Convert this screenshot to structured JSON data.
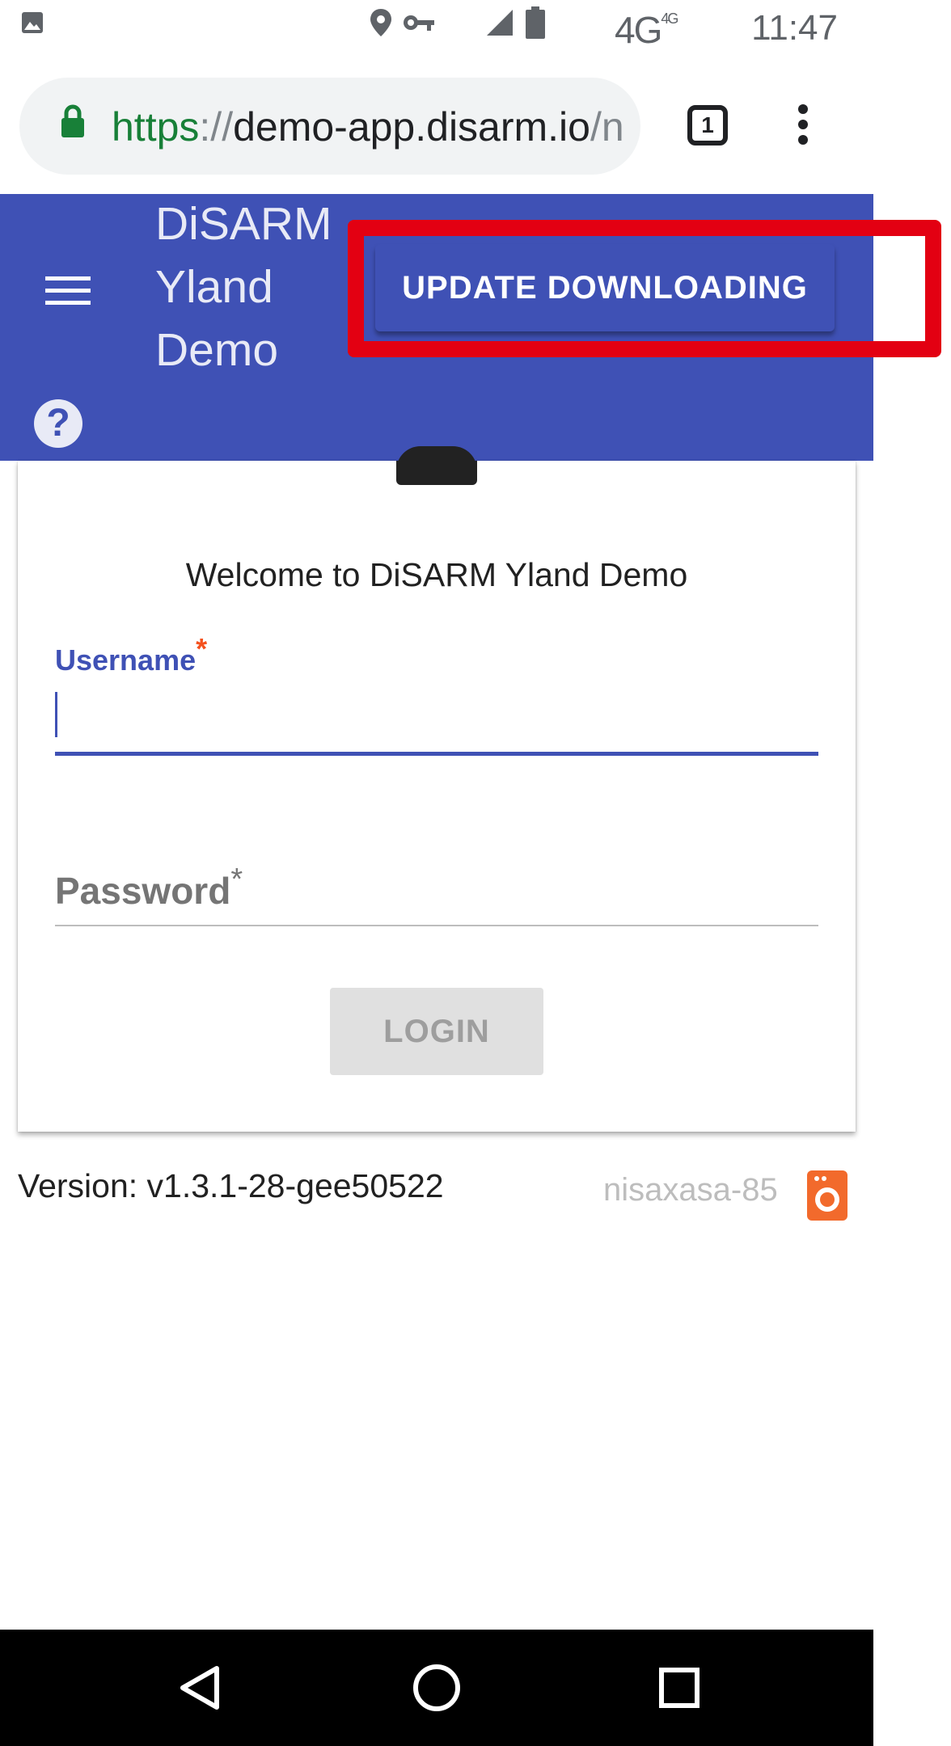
{
  "status_bar": {
    "network": "4G",
    "network_small": "4G",
    "time": "11:47",
    "icons": [
      "image-icon",
      "location-icon",
      "vpn-key-icon",
      "signal-icon",
      "battery-icon"
    ]
  },
  "browser": {
    "url_scheme": "https",
    "url_sep": "://",
    "url_host": "demo-app.disarm.io",
    "url_rest": "/n",
    "tab_count": "1"
  },
  "app_bar": {
    "title_line1": "DiSARM",
    "title_line2": "Yland",
    "title_line3": "Demo",
    "update_button": "UPDATE DOWNLOADING",
    "help_glyph": "?"
  },
  "login": {
    "welcome": "Welcome to DiSARM Yland Demo",
    "username_label": "Username",
    "username_value": "",
    "password_label": "Password",
    "required_marker": "*",
    "login_button": "LOGIN"
  },
  "footer": {
    "version": "Version: v1.3.1-28-gee50522",
    "device_id": "nisaxasa-85"
  },
  "colors": {
    "primary": "#3f51b5",
    "highlight": "#e30012",
    "accent_required": "#f4511e"
  }
}
